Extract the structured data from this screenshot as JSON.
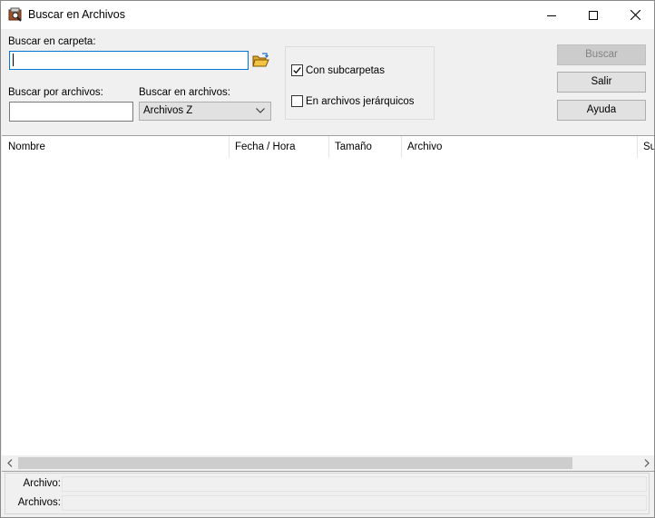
{
  "window": {
    "title": "Buscar en Archivos",
    "icon": "archive-search-icon",
    "controls": [
      "minimize-icon",
      "maximize-icon",
      "close-icon"
    ]
  },
  "form": {
    "folder_label": "Buscar en carpeta:",
    "folder_value": "",
    "folder_button_icon": "open-folder-icon",
    "files_label": "Buscar por archivos:",
    "files_value": "",
    "archives_label": "Buscar en archivos:",
    "archives_selected": "Archivos Z"
  },
  "options": {
    "subfolders_label": "Con subcarpetas",
    "subfolders_checked": true,
    "hierarchical_label": "En archivos jerárquicos",
    "hierarchical_checked": false
  },
  "buttons": {
    "search": "Buscar",
    "exit": "Salir",
    "help": "Ayuda"
  },
  "results": {
    "columns": [
      "Nombre",
      "Fecha / Hora",
      "Tamaño",
      "Archivo",
      "Su"
    ],
    "rows": []
  },
  "status": {
    "archive_label": "Archivo:",
    "archive_value": "",
    "archives_label": "Archivos:",
    "archives_value": ""
  },
  "colors": {
    "focus_border": "#0078d7",
    "button_face": "#e1e1e1",
    "dialog_bg": "#f0f0f0",
    "folder_icon": "#f4c542"
  }
}
